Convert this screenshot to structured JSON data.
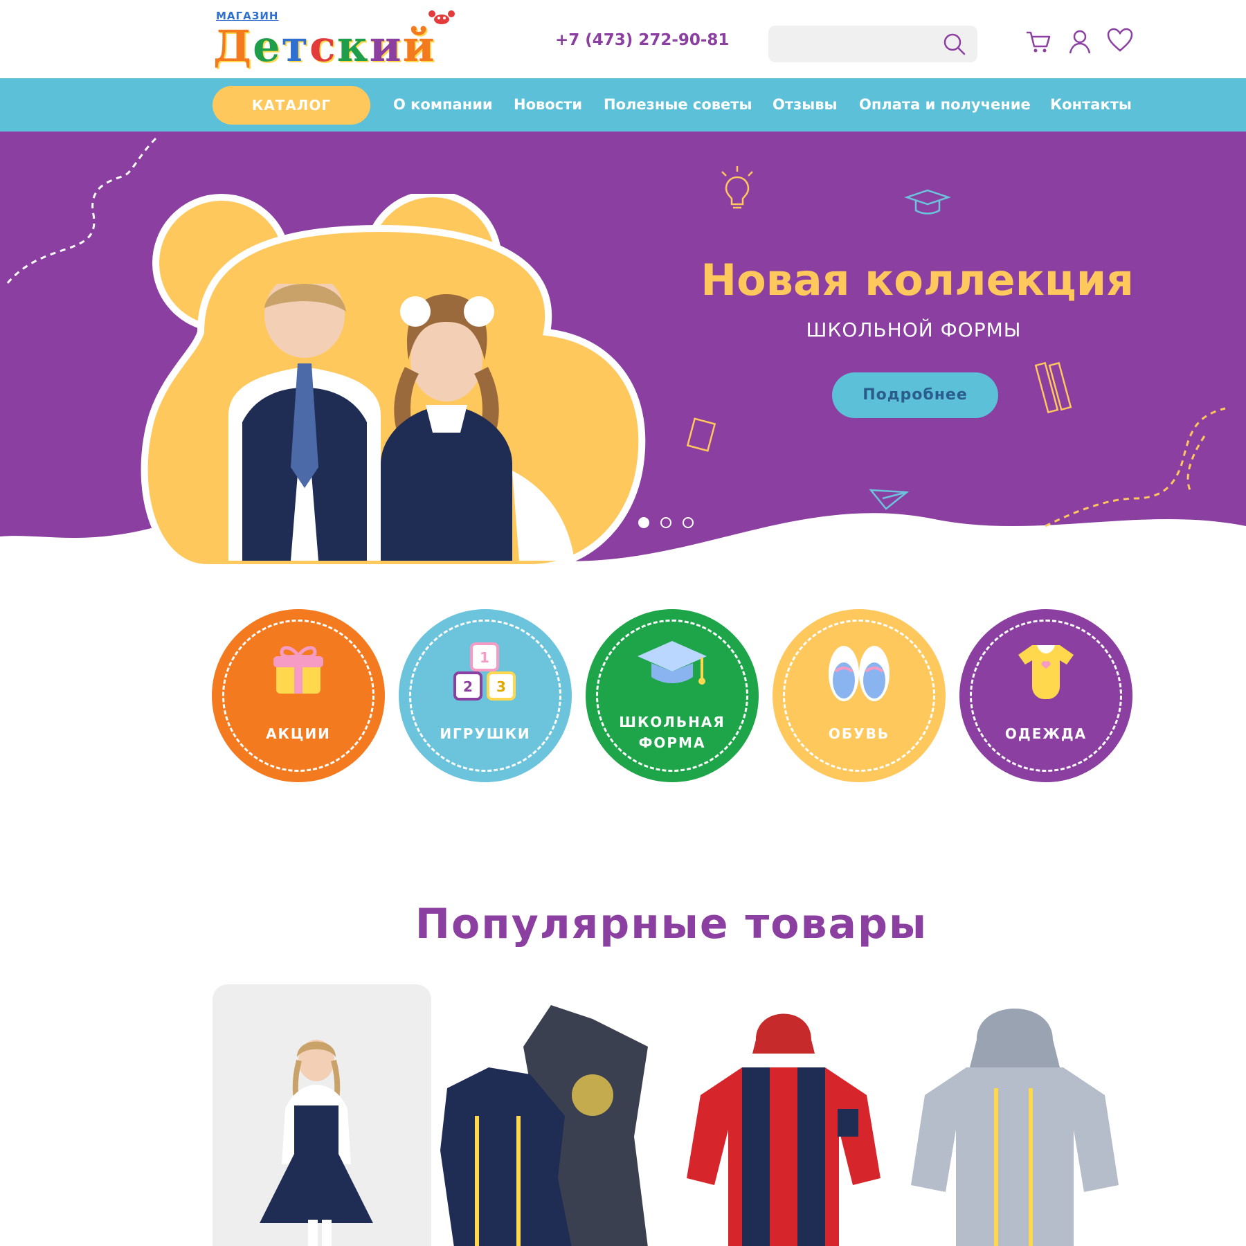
{
  "header": {
    "logo_small": "МАГАЗИН",
    "logo_letters": [
      "Д",
      "е",
      "т",
      "с",
      "к",
      "и",
      "й"
    ],
    "logo_colors": [
      "#f47a20",
      "#1e9e4a",
      "#2f6fd0",
      "#e23b3b",
      "#1e9e4a",
      "#8b3fa0",
      "#f47a20"
    ],
    "phone": "+7 (473) 272-90-81",
    "search_placeholder": "",
    "icons": [
      "cart-icon",
      "user-icon",
      "heart-icon"
    ]
  },
  "nav": {
    "catalog_label": "КАТАЛОГ",
    "items": [
      "О компании",
      "Новости",
      "Полезные советы",
      "Отзывы",
      "Оплата и получение",
      "Контакты"
    ]
  },
  "hero": {
    "title": "Новая коллекция",
    "subtitle": "ШКОЛЬНОЙ ФОРМЫ",
    "button_label": "Подробнее",
    "slides": 3,
    "active_slide": 1,
    "background_color": "#8b3fa0",
    "accent_color": "#ffc85c"
  },
  "categories": [
    {
      "label": "АКЦИИ",
      "color": "#f47a20",
      "icon": "gift-icon"
    },
    {
      "label": "ИГРУШКИ",
      "color": "#6cc4dc",
      "icon": "toy-blocks-icon"
    },
    {
      "label_line1": "ШКОЛЬНАЯ",
      "label_line2": "ФОРМА",
      "color": "#1ea54a",
      "icon": "graduation-cap-icon"
    },
    {
      "label": "ОБУВЬ",
      "color": "#ffc85c",
      "icon": "baby-shoes-icon"
    },
    {
      "label": "ОДЕЖДА",
      "color": "#8b3fa0",
      "icon": "bodysuit-icon"
    }
  ],
  "popular": {
    "title": "Популярные товары",
    "products": [
      "school-dress-photo",
      "camo-jackets-photo",
      "red-jacket-photo",
      "silver-jacket-photo"
    ]
  }
}
